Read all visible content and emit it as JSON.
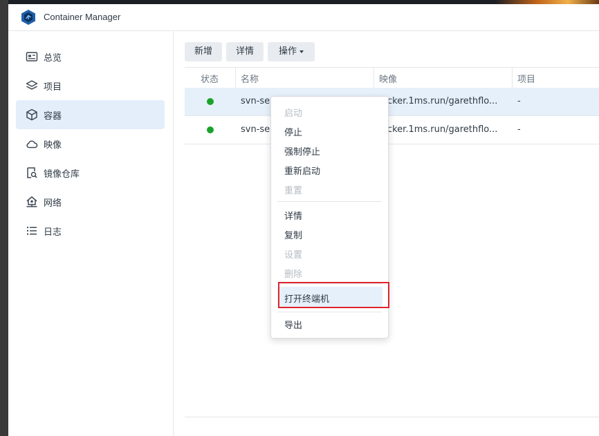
{
  "app": {
    "title": "Container Manager",
    "logo_icon": "container-manager-logo"
  },
  "sidebar": {
    "items": [
      {
        "label": "总览",
        "icon": "overview-icon",
        "active": false
      },
      {
        "label": "项目",
        "icon": "layers-icon",
        "active": false
      },
      {
        "label": "容器",
        "icon": "cube-icon",
        "active": true
      },
      {
        "label": "映像",
        "icon": "cloud-icon",
        "active": false
      },
      {
        "label": "镜像仓库",
        "icon": "registry-search-icon",
        "active": false
      },
      {
        "label": "网络",
        "icon": "network-house-icon",
        "active": false
      },
      {
        "label": "日志",
        "icon": "list-icon",
        "active": false
      }
    ]
  },
  "toolbar": {
    "add_label": "新增",
    "details_label": "详情",
    "action_label": "操作"
  },
  "table": {
    "columns": [
      "状态",
      "名称",
      "映像",
      "项目"
    ],
    "rows": [
      {
        "status": "running",
        "name": "svn-se",
        "image": "ocker.1ms.run/garethflo...",
        "project": "-",
        "selected": true
      },
      {
        "status": "running",
        "name": "svn-se",
        "image": "ocker.1ms.run/garethflo...",
        "project": "-",
        "selected": false
      }
    ]
  },
  "context_menu": {
    "groups": [
      [
        {
          "label": "启动",
          "disabled": true
        },
        {
          "label": "停止",
          "disabled": false
        },
        {
          "label": "强制停止",
          "disabled": false
        },
        {
          "label": "重新启动",
          "disabled": false
        },
        {
          "label": "重置",
          "disabled": true
        }
      ],
      [
        {
          "label": "详情",
          "disabled": false
        },
        {
          "label": "复制",
          "disabled": false
        },
        {
          "label": "设置",
          "disabled": true
        },
        {
          "label": "删除",
          "disabled": true
        }
      ],
      [
        {
          "label": "打开终端机",
          "disabled": false,
          "hovered": true,
          "highlighted": true
        }
      ],
      [
        {
          "label": "导出",
          "disabled": false
        }
      ]
    ]
  },
  "colors": {
    "accent": "#e3eefa",
    "status_running": "#1aa32b",
    "highlight_box": "#e0242d"
  }
}
